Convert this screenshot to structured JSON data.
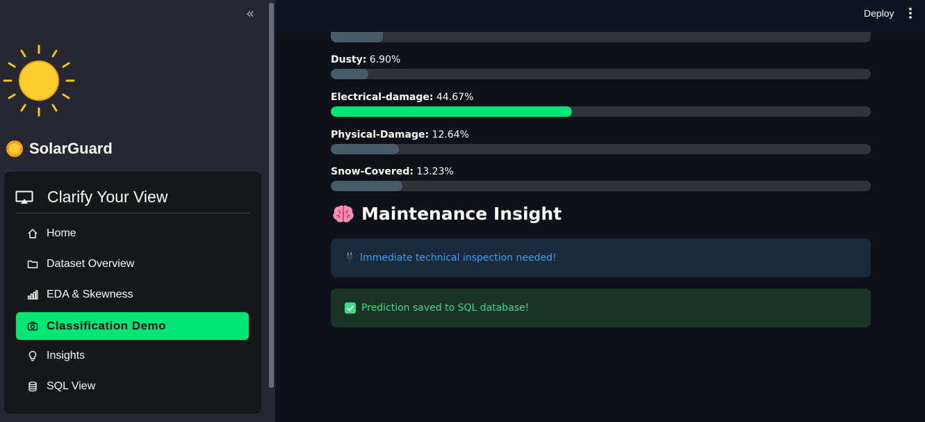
{
  "topbar": {
    "deploy_label": "Deploy"
  },
  "sidebar": {
    "brand_title": "SolarGuard",
    "nav_title": "Clarify Your View",
    "items": [
      {
        "label": "Home",
        "icon": "house-icon"
      },
      {
        "label": "Dataset Overview",
        "icon": "folder-icon"
      },
      {
        "label": "EDA & Skewness",
        "icon": "bar-chart-icon"
      },
      {
        "label": "Classification Demo",
        "icon": "camera-icon",
        "active": true
      },
      {
        "label": "Insights",
        "icon": "lightbulb-icon"
      },
      {
        "label": "SQL View",
        "icon": "database-icon"
      }
    ]
  },
  "probabilities": [
    {
      "name": "",
      "value_text": "",
      "fraction": 0.096
    },
    {
      "name": "Dusty:",
      "value_text": "6.90%",
      "fraction": 0.069
    },
    {
      "name": "Electrical-damage:",
      "value_text": "44.67%",
      "fraction": 0.4467,
      "highlight": true
    },
    {
      "name": "Physical-Damage:",
      "value_text": "12.64%",
      "fraction": 0.1264
    },
    {
      "name": "Snow-Covered:",
      "value_text": "13.23%",
      "fraction": 0.1323
    }
  ],
  "insight": {
    "title": "Maintenance Insight",
    "info_message": "Immediate technical inspection needed!",
    "success_message": "Prediction saved to SQL database!"
  },
  "colors": {
    "accent": "#00e676",
    "info": "#3d9df3",
    "success": "#3ddc84"
  }
}
